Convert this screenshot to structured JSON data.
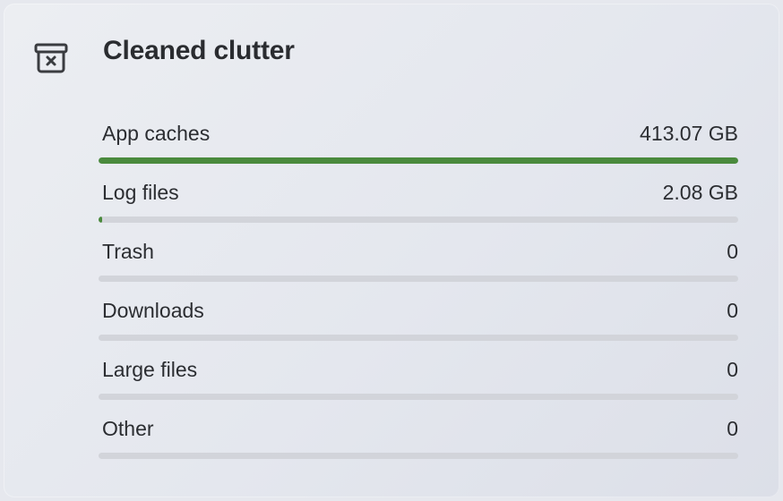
{
  "card": {
    "title": "Cleaned clutter",
    "icon": "trash-bin-x-icon",
    "accent_color": "#4a8a3d",
    "track_color": "#d2d4da"
  },
  "items": [
    {
      "label": "App caches",
      "value": "413.07 GB",
      "fraction": 1.0
    },
    {
      "label": "Log files",
      "value": "2.08 GB",
      "fraction": 0.005
    },
    {
      "label": "Trash",
      "value": "0",
      "fraction": 0
    },
    {
      "label": "Downloads",
      "value": "0",
      "fraction": 0
    },
    {
      "label": "Large files",
      "value": "0",
      "fraction": 0
    },
    {
      "label": "Other",
      "value": "0",
      "fraction": 0
    }
  ]
}
